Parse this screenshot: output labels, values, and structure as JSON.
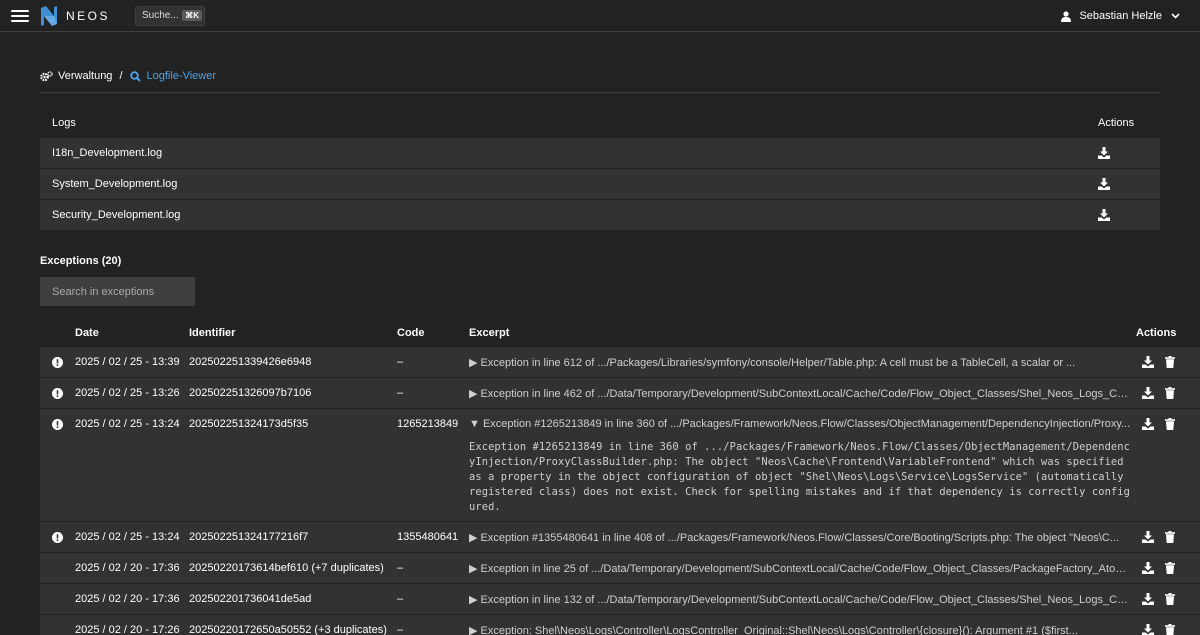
{
  "topbar": {
    "brand": "NEOS",
    "search_label": "Suche...",
    "search_shortcut": "⌘K",
    "user_name": "Sebastian Helzle"
  },
  "breadcrumb": {
    "root": "Verwaltung",
    "separator": "/",
    "current": "Logfile-Viewer"
  },
  "logs": {
    "header_name": "Logs",
    "header_actions": "Actions",
    "files": [
      {
        "name": "I18n_Development.log"
      },
      {
        "name": "System_Development.log"
      },
      {
        "name": "Security_Development.log"
      }
    ]
  },
  "exceptions": {
    "title": "Exceptions (20)",
    "search_placeholder": "Search in exceptions",
    "headers": {
      "date": "Date",
      "identifier": "Identifier",
      "code": "Code",
      "excerpt": "Excerpt",
      "actions": "Actions"
    },
    "rows": [
      {
        "date": "2025 / 02 / 25 - 13:39",
        "identifier": "202502251339426e6948",
        "code": "–",
        "excerpt": "▶ Exception in line 612 of .../Packages/Libraries/symfony/console/Helper/Table.php: A cell must be a TableCell, a scalar or ..."
      },
      {
        "date": "2025 / 02 / 25 - 13:26",
        "identifier": "202502251326097b7106",
        "code": "–",
        "excerpt": "▶ Exception in line 462 of .../Data/Temporary/Development/SubContextLocal/Cache/Code/Flow_Object_Classes/Shel_Neos_Logs_Cont..."
      },
      {
        "date": "2025 / 02 / 25 - 13:24",
        "identifier": "202502251324173d5f35",
        "code": "1265213849",
        "excerpt": "▼ Exception #1265213849 in line 360 of .../Packages/Framework/Neos.Flow/Classes/ObjectManagement/DependencyInjection/Proxy...",
        "detail": "Exception #1265213849 in line 360 of .../Packages/Framework/Neos.Flow/Classes/ObjectManagement/DependencyInjection/ProxyClassBuilder.php: The object \"Neos\\Cache\\Frontend\\VariableFrontend\" which was specified as a property in the object configuration of object \"Shel\\Neos\\Logs\\Service\\LogsService\" (automatically registered class) does not exist. Check for spelling mistakes and if that dependency is correctly configured."
      },
      {
        "date": "2025 / 02 / 25 - 13:24",
        "identifier": "202502251324177216f7",
        "code": "1355480641",
        "excerpt": "▶ Exception #1355480641 in line 408 of .../Packages/Framework/Neos.Flow/Classes/Core/Booting/Scripts.php: The object \"Neos\\C..."
      },
      {
        "date": "2025 / 02 / 20 - 17:36",
        "identifier": "20250220173614bef610 (+7 duplicates)",
        "code": "–",
        "excerpt": "▶ Exception in line 25 of .../Data/Temporary/Development/SubContextLocal/Cache/Code/Flow_Object_Classes/PackageFactory_Atomi..."
      },
      {
        "date": "2025 / 02 / 20 - 17:36",
        "identifier": "202502201736041de5ad",
        "code": "–",
        "excerpt": "▶ Exception in line 132 of .../Data/Temporary/Development/SubContextLocal/Cache/Code/Flow_Object_Classes/Shel_Neos_Logs_Cont..."
      },
      {
        "date": "2025 / 02 / 20 - 17:26",
        "identifier": "20250220172650a50552 (+3 duplicates)",
        "code": "–",
        "excerpt": "▶ Exception: Shel\\Neos\\Logs\\Controller\\LogsController_Original::Shel\\Neos\\Logs\\Controller\\{closure}(): Argument #1 ($first..."
      }
    ]
  },
  "colors": {
    "background": "#222222",
    "row": "#323232",
    "input": "#3f3f3f",
    "accent": "#4aa3e8",
    "text": "#ffffff"
  }
}
